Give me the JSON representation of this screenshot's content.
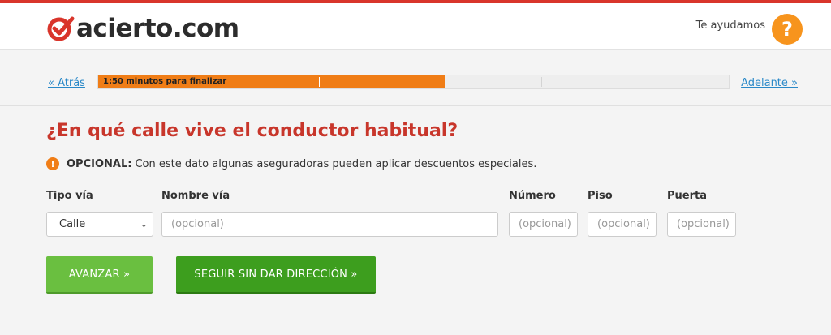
{
  "header": {
    "logo_text": "acierto.com",
    "help_text": "Te ayudamos",
    "help_icon": "?"
  },
  "progress": {
    "back_label": "« Atrás",
    "next_label": "Adelante »",
    "time_label": "1:50 minutos para finalizar",
    "percent": 55
  },
  "question": {
    "title": "¿En qué calle vive el conductor habitual?",
    "note_prefix": "OPCIONAL:",
    "note_text": "Con este dato algunas aseguradoras pueden aplicar descuentos especiales.",
    "note_icon": "!"
  },
  "form": {
    "tipo_via": {
      "label": "Tipo vía",
      "value": "Calle"
    },
    "nombre_via": {
      "label": "Nombre vía",
      "placeholder": "(opcional)"
    },
    "numero": {
      "label": "Número",
      "placeholder": "(opcional)"
    },
    "piso": {
      "label": "Piso",
      "placeholder": "(opcional)"
    },
    "puerta": {
      "label": "Puerta",
      "placeholder": "(opcional)"
    }
  },
  "actions": {
    "primary_label": "AVANZAR »",
    "secondary_label": "SEGUIR SIN DAR DIRECCIÓN »"
  },
  "colors": {
    "brand_red": "#d9352b",
    "title_red": "#c8362b",
    "orange": "#f07d16",
    "green_primary": "#6abf40",
    "green_secondary": "#3d9e1e",
    "link_blue": "#2a89c8"
  }
}
